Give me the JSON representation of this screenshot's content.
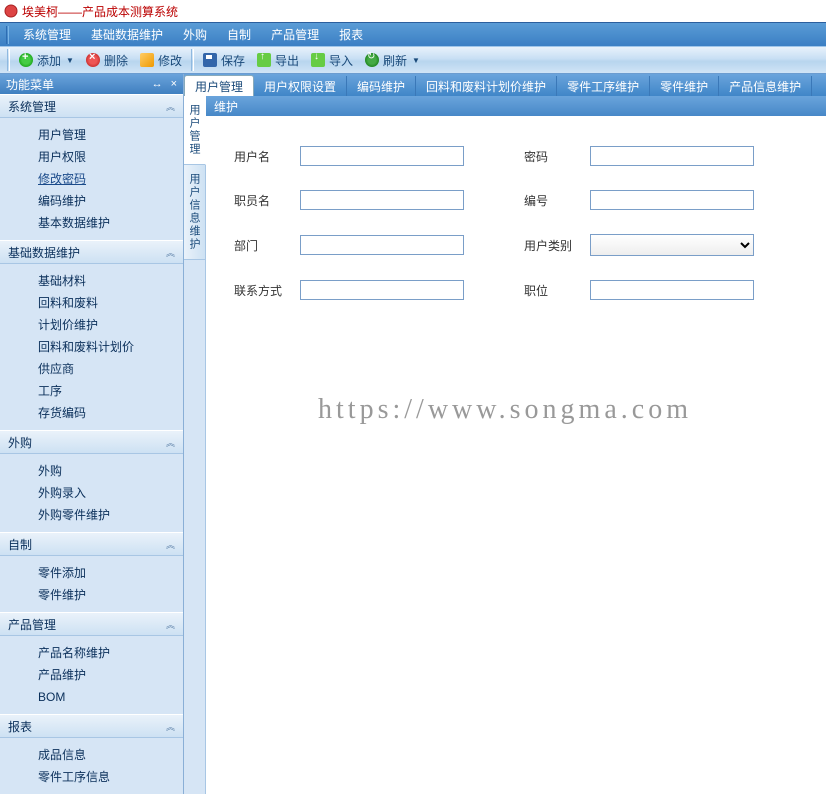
{
  "titlebar": {
    "text": "埃美柯——产品成本测算系统"
  },
  "menubar": {
    "items": [
      "系统管理",
      "基础数据维护",
      "外购",
      "自制",
      "产品管理",
      "报表"
    ]
  },
  "toolbar": {
    "buttons": [
      {
        "label": "添加",
        "icon": "add",
        "dropdown": true
      },
      {
        "label": "删除",
        "icon": "del"
      },
      {
        "label": "修改",
        "icon": "edit"
      },
      {
        "label": "保存",
        "icon": "save"
      },
      {
        "label": "导出",
        "icon": "export"
      },
      {
        "label": "导入",
        "icon": "import"
      },
      {
        "label": "刷新",
        "icon": "refresh",
        "dropdown": true
      }
    ]
  },
  "sidebar": {
    "title": "功能菜单",
    "sections": [
      {
        "title": "系统管理",
        "items": [
          "用户管理",
          "用户权限",
          "修改密码",
          "编码维护",
          "基本数据维护"
        ],
        "activeIndex": 2
      },
      {
        "title": "基础数据维护",
        "items": [
          "基础材料",
          "回料和废料",
          "计划价维护",
          "回料和废料计划价",
          "供应商",
          "工序",
          "存货编码"
        ]
      },
      {
        "title": "外购",
        "items": [
          "外购",
          "外购录入",
          "外购零件维护"
        ]
      },
      {
        "title": "自制",
        "items": [
          "零件添加",
          "零件维护"
        ]
      },
      {
        "title": "产品管理",
        "items": [
          "产品名称维护",
          "产品维护",
          "BOM"
        ]
      },
      {
        "title": "报表",
        "items": [
          "成品信息",
          "零件工序信息"
        ]
      }
    ]
  },
  "tabs": {
    "items": [
      "用户管理",
      "用户权限设置",
      "编码维护",
      "回料和废料计划价维护",
      "零件工序维护",
      "零件维护",
      "产品信息维护"
    ],
    "activeIndex": 0
  },
  "vtabs": {
    "items": [
      "用户管理",
      "用户信息维护"
    ],
    "activeIndex": 0
  },
  "panel": {
    "title": "维护",
    "fields": {
      "username_label": "用户名",
      "username_value": "",
      "password_label": "密码",
      "password_value": "",
      "staffname_label": "职员名",
      "staffname_value": "",
      "code_label": "编号",
      "code_value": "",
      "dept_label": "部门",
      "dept_value": "",
      "usercat_label": "用户类别",
      "usercat_value": "",
      "contact_label": "联系方式",
      "contact_value": "",
      "position_label": "职位",
      "position_value": ""
    }
  },
  "watermark": "https://www.songma.com"
}
